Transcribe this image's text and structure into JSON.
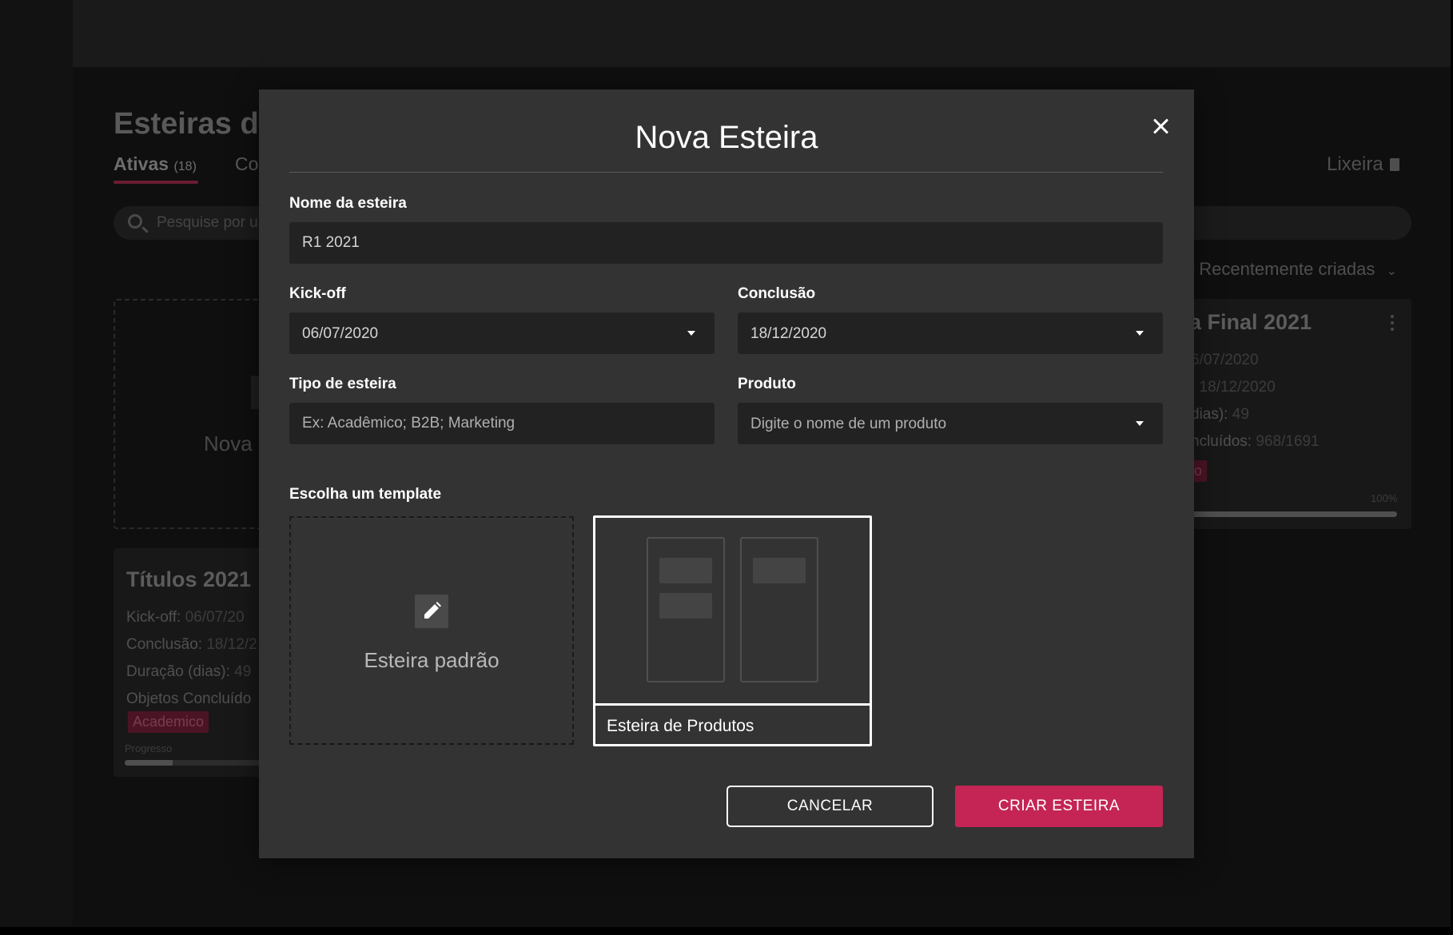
{
  "background": {
    "page_title": "Esteiras d",
    "tabs": [
      {
        "label": "Ativas",
        "count": "(18)"
      },
      {
        "label": "Co"
      }
    ],
    "trash_label": "Lixeira",
    "search_placeholder": "Pesquise por u",
    "sort_label": ": Recentemente criadas",
    "new_card_label": "Nova",
    "card_left": {
      "title": "Títulos 2021",
      "kickoff_label": "Kick-off:",
      "kickoff_value": "06/07/20",
      "conclusion_label": "Conclusão:",
      "conclusion_value": "18/12/2",
      "duration_label": "Duração (dias):",
      "duration_value": "49",
      "objects_label": "Objetos Concluído",
      "tag": "Academico",
      "progress_label": "Progresso",
      "progress_fraction": 0.29
    },
    "card_right": {
      "title": "a Final 2021",
      "kickoff_value": "6/07/2020",
      "conclusion_value": ": 18/12/2020",
      "duration_label": "dias):",
      "duration_value": "49",
      "objects_label": "ncluídos:",
      "objects_value": "968/1691",
      "tag": "o",
      "progress_percent": "100%",
      "progress_fraction": 1.0
    }
  },
  "modal": {
    "title": "Nova Esteira",
    "name_label": "Nome da esteira",
    "name_value": "R1 2021",
    "kickoff_label": "Kick-off",
    "kickoff_value": "06/07/2020",
    "conclusion_label": "Conclusão",
    "conclusion_value": "18/12/2020",
    "type_label": "Tipo de esteira",
    "type_placeholder": "Ex: Acadêmico; B2B; Marketing",
    "product_label": "Produto",
    "product_placeholder": "Digite o nome de um produto",
    "template_label": "Escolha um template",
    "template_blank_label": "Esteira padrão",
    "template_products_label": "Esteira de Produtos",
    "cancel_label": "CANCELAR",
    "create_label": "CRIAR ESTEIRA"
  },
  "colors": {
    "accent": "#c42554",
    "modal_bg": "#333333",
    "field_bg": "#222222"
  }
}
